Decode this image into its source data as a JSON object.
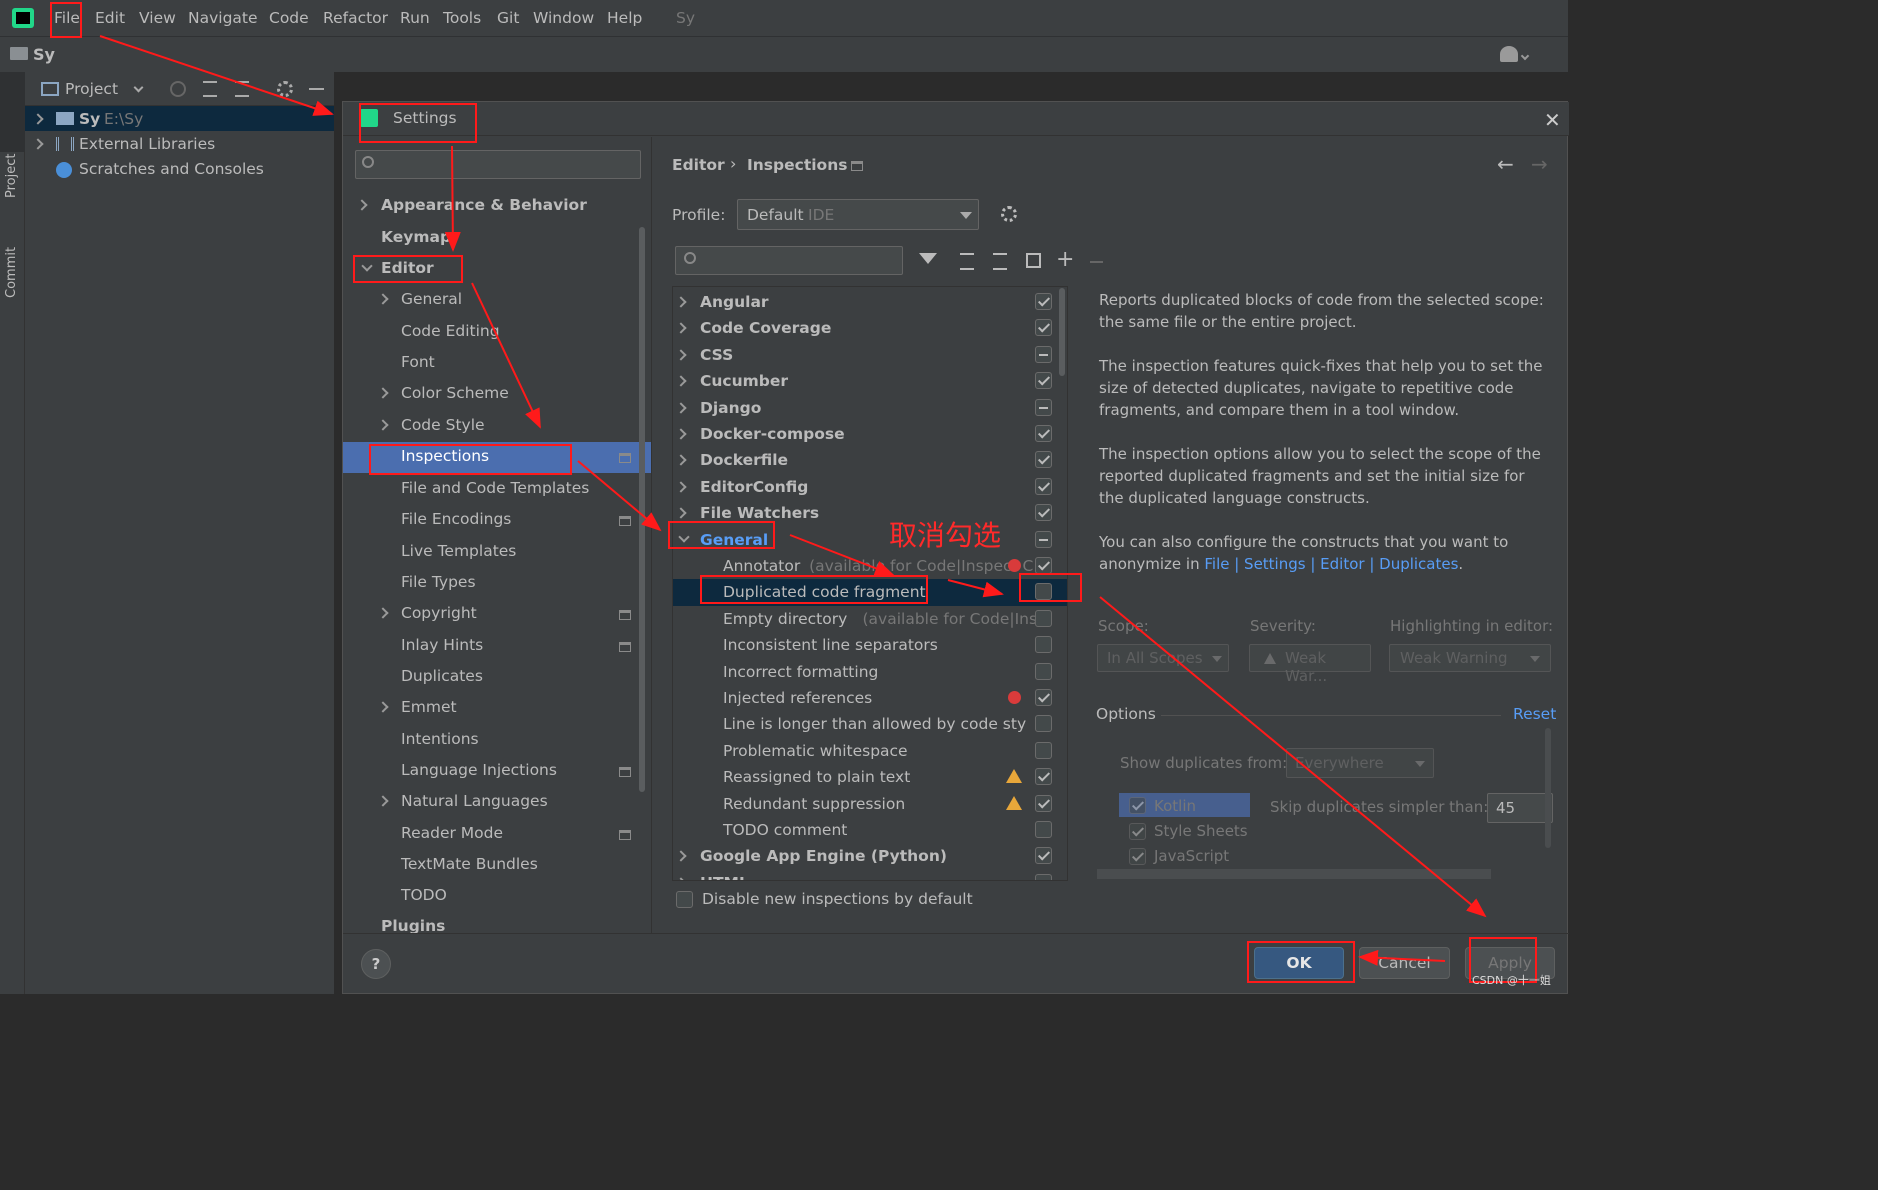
{
  "menubar": {
    "items": [
      "File",
      "Edit",
      "View",
      "Navigate",
      "Code",
      "Refactor",
      "Run",
      "Tools",
      "Git",
      "Window",
      "Help"
    ],
    "project_name": "Sy"
  },
  "navbar": {
    "crumb": "Sy"
  },
  "side_strip": {
    "project": "Project",
    "commit": "Commit"
  },
  "project_panel": {
    "title": "Project",
    "tree": [
      {
        "name": "Sy",
        "path": "E:\\Sy"
      },
      {
        "name": "External Libraries"
      },
      {
        "name": "Scratches and Consoles"
      }
    ]
  },
  "dialog": {
    "title": "Settings",
    "search_placeholder": "",
    "left_tree": {
      "appearance": "Appearance & Behavior",
      "keymap": "Keymap",
      "editor": "Editor",
      "children": [
        "General",
        "Code Editing",
        "Font",
        "Color Scheme",
        "Code Style",
        "Inspections",
        "File and Code Templates",
        "File Encodings",
        "Live Templates",
        "File Types",
        "Copyright",
        "Inlay Hints",
        "Duplicates",
        "Emmet",
        "Intentions",
        "Language Injections",
        "Natural Languages",
        "Reader Mode",
        "TextMate Bundles",
        "TODO"
      ],
      "plugins": "Plugins"
    },
    "breadcrumb": {
      "editor": "Editor",
      "sep": "›",
      "page": "Inspections"
    },
    "profile": {
      "label": "Profile:",
      "value": "Default",
      "scope": "IDE"
    },
    "inspections": [
      {
        "label": "Angular",
        "state": "on",
        "group": true
      },
      {
        "label": "Code Coverage",
        "state": "on",
        "group": true
      },
      {
        "label": "CSS",
        "state": "partial",
        "group": true
      },
      {
        "label": "Cucumber",
        "state": "on",
        "group": true
      },
      {
        "label": "Django",
        "state": "partial",
        "group": true
      },
      {
        "label": "Docker-compose",
        "state": "on",
        "group": true
      },
      {
        "label": "Dockerfile",
        "state": "on",
        "group": true
      },
      {
        "label": "EditorConfig",
        "state": "on",
        "group": true
      },
      {
        "label": "File Watchers",
        "state": "on",
        "group": true
      },
      {
        "label": "General",
        "state": "partial",
        "group": true,
        "expanded": true
      },
      {
        "label": "Annotator",
        "note": "(available for Code|Inspect C",
        "state": "on",
        "badge": "error"
      },
      {
        "label": "Duplicated code fragment",
        "state": "off",
        "selected": true
      },
      {
        "label": "Empty directory",
        "note": "(available for Code|Ins",
        "state": "off"
      },
      {
        "label": "Inconsistent line separators",
        "state": "off"
      },
      {
        "label": "Incorrect formatting",
        "state": "off"
      },
      {
        "label": "Injected references",
        "state": "on",
        "badge": "error"
      },
      {
        "label": "Line is longer than allowed by code sty",
        "state": "off"
      },
      {
        "label": "Problematic whitespace",
        "state": "off"
      },
      {
        "label": "Reassigned to plain text",
        "state": "on",
        "badge": "warning"
      },
      {
        "label": "Redundant suppression",
        "state": "on",
        "badge": "warning"
      },
      {
        "label": "TODO comment",
        "state": "off"
      },
      {
        "label": "Google App Engine (Python)",
        "state": "on",
        "group": true
      },
      {
        "label": "HTML",
        "state": "partial",
        "group": true
      }
    ],
    "disable_new_label": "Disable new inspections by default",
    "description": {
      "p1": "Reports duplicated blocks of code from the selected scope: the same file or the entire project.",
      "p2": "The inspection features quick-fixes that help you to set the size of detected duplicates, navigate to repetitive code fragments, and compare them in a tool window.",
      "p3": "The inspection options allow you to select the scope of the reported duplicated fragments and set the initial size for the duplicated language constructs.",
      "p4_prefix": "You can also configure the constructs that you want to anonymize in ",
      "p4_link": "File | Settings | Editor | Duplicates",
      "p4_suffix": "."
    },
    "scope": {
      "label": "Scope:",
      "value": "In All Scopes"
    },
    "severity": {
      "label": "Severity:",
      "value": "Weak War..."
    },
    "highlighting": {
      "label": "Highlighting in editor:",
      "value": "Weak Warning"
    },
    "options": {
      "label": "Options",
      "reset": "Reset",
      "show_from_label": "Show duplicates from:",
      "show_from_value": "Everywhere",
      "languages": [
        {
          "name": "Kotlin",
          "checked": true
        },
        {
          "name": "Style Sheets",
          "checked": true
        },
        {
          "name": "JavaScript",
          "checked": true
        }
      ],
      "skip_label": "Skip duplicates simpler than:",
      "skip_value": "45"
    },
    "buttons": {
      "ok": "OK",
      "cancel": "Cancel",
      "apply": "Apply"
    },
    "help": "?"
  },
  "annotation": {
    "text": "取消勾选",
    "color": "#ff2a2a"
  },
  "watermark": "CSDN @十一姐"
}
